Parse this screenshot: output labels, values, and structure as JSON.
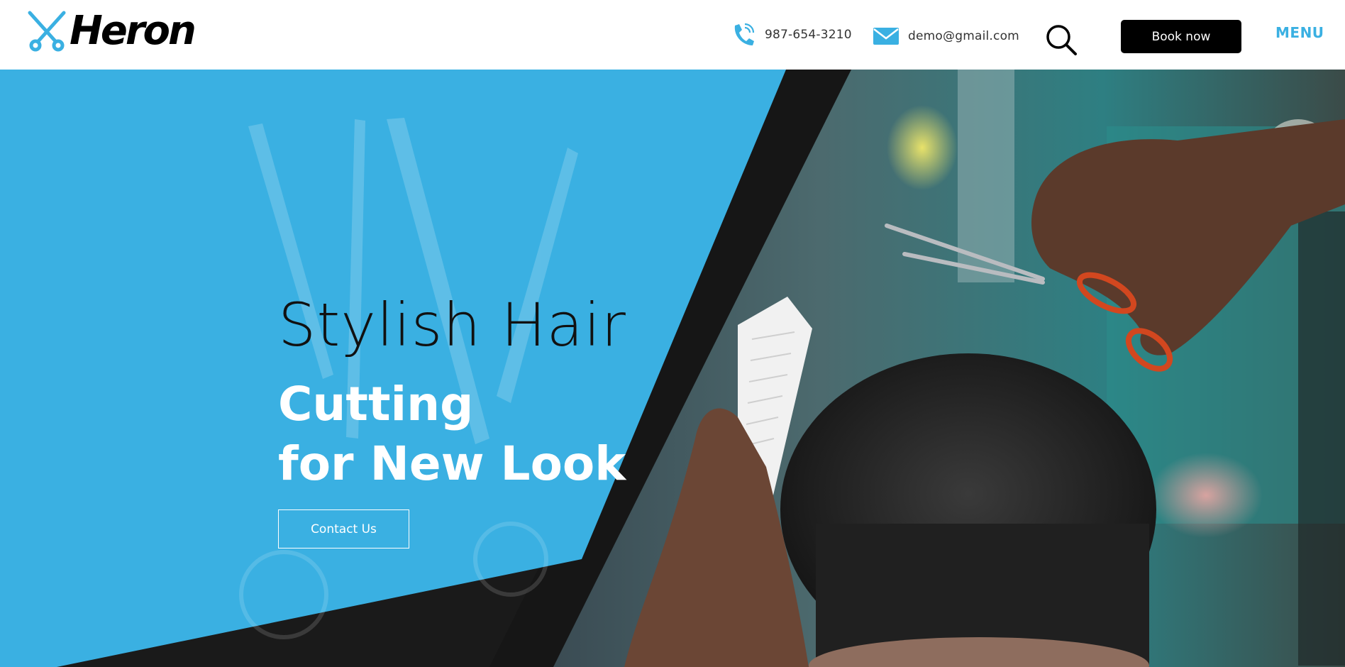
{
  "brand": {
    "name": "Heron",
    "accent_color": "#3ab0e2"
  },
  "header": {
    "phone": {
      "icon": "phone-icon",
      "text": "987-654-3210"
    },
    "email": {
      "icon": "envelope-icon",
      "text": "demo@gmail.com"
    },
    "search": {
      "icon": "search-icon"
    },
    "book_label": "Book now",
    "menu_label": "MENU"
  },
  "hero": {
    "title_light": "Stylish Hair",
    "title_bold_line1": "Cutting",
    "title_bold_line2": "for New Look",
    "cta_label": "Contact Us",
    "panel_color": "#3ab0e2",
    "image": "photo of barber cutting a man's dark hair with scissors and comb"
  }
}
